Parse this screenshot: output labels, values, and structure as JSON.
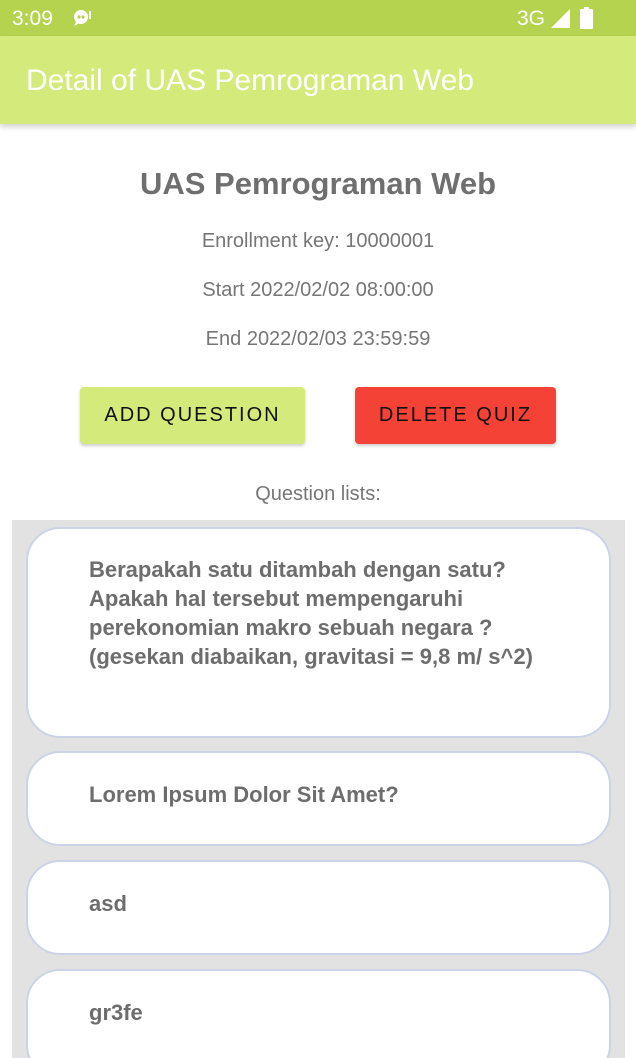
{
  "status_bar": {
    "time": "3:09",
    "network": "3G",
    "icons": [
      "notification-icon",
      "signal-icon",
      "battery-icon"
    ]
  },
  "app_bar": {
    "title": "Detail of UAS Pemrograman Web",
    "color": "#d4ea7a"
  },
  "quiz": {
    "title": "UAS Pemrograman Web",
    "enrollment": "Enrollment key: 10000001",
    "start": "Start 2022/02/02 08:00:00",
    "end": "End 2022/02/03 23:59:59"
  },
  "actions": {
    "add_question": "ADD QUESTION",
    "delete_quiz": "DELETE QUIZ",
    "add_color": "#d4ea7a",
    "delete_color": "#f44336"
  },
  "questions": {
    "label": "Question lists:",
    "items": [
      {
        "text": "Berapakah satu ditambah dengan satu? Apakah hal tersebut mempengaruhi perekonomian makro sebuah negara ? (gesekan diabaikan, gravitasi = 9,8 m/ s^2)"
      },
      {
        "text": "Lorem Ipsum Dolor Sit Amet?"
      },
      {
        "text": "asd"
      },
      {
        "text": "gr3fe"
      }
    ]
  }
}
